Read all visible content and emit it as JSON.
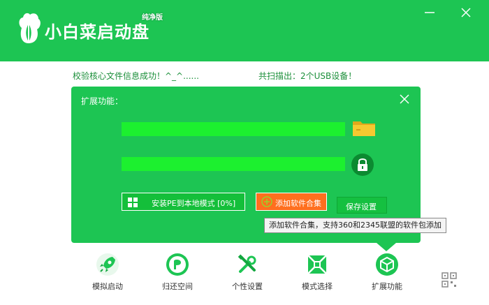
{
  "app": {
    "title": "小白菜启动盘",
    "edition": "纯净版"
  },
  "status": {
    "verify": "校验核心文件信息成功！^_^......",
    "scan": "共扫描出：2个USB设备！"
  },
  "panel": {
    "title": "扩展功能：",
    "install_button": "安装PE到本地模式 [0%]",
    "add_software_button": "添加软件合集",
    "save_button": "保存设置"
  },
  "tooltip": {
    "text": "添加软件合集，支持360和2345联盟的软件包添加"
  },
  "nav": {
    "items": [
      {
        "label": "模拟启动",
        "icon": "rocket-icon"
      },
      {
        "label": "归还空间",
        "icon": "restore-space-icon"
      },
      {
        "label": "个性设置",
        "icon": "tools-icon"
      },
      {
        "label": "模式选择",
        "icon": "mode-icon"
      },
      {
        "label": "扩展功能",
        "icon": "cube-icon"
      }
    ]
  },
  "colors": {
    "brand_green": "#1dc553",
    "field_green": "#1cf02f",
    "accent_orange": "#ff6f1e"
  }
}
